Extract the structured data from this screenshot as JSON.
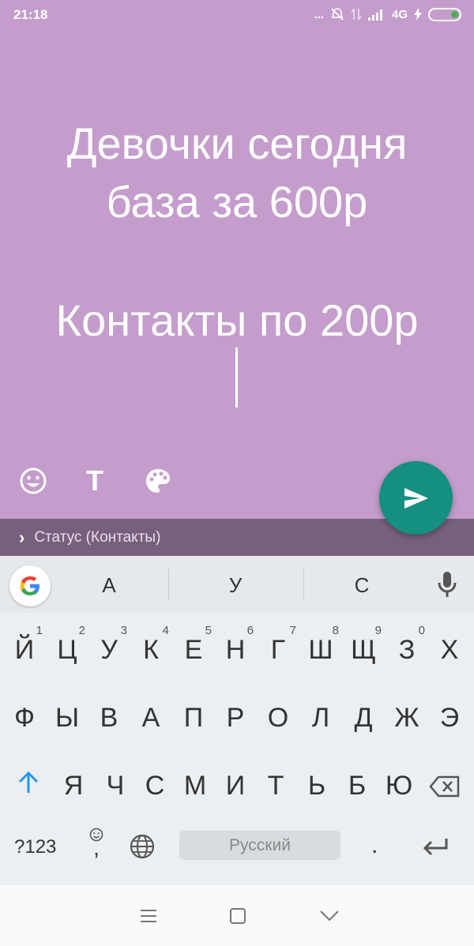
{
  "status_bar": {
    "time": "21:18",
    "dots": "...",
    "network": "4G"
  },
  "editor": {
    "lines": [
      "Девочки сегодня",
      "база за 600р",
      "Контакты по 200р"
    ],
    "background_color": "#c49dcc",
    "tools": {
      "text_tool_label": "T"
    }
  },
  "audience": {
    "label": "Статус (Контакты)"
  },
  "keyboard": {
    "suggestions": [
      "А",
      "У",
      "С"
    ],
    "row1": [
      {
        "ch": "Й",
        "num": "1"
      },
      {
        "ch": "Ц",
        "num": "2"
      },
      {
        "ch": "У",
        "num": "3"
      },
      {
        "ch": "К",
        "num": "4"
      },
      {
        "ch": "Е",
        "num": "5"
      },
      {
        "ch": "Н",
        "num": "6"
      },
      {
        "ch": "Г",
        "num": "7"
      },
      {
        "ch": "Ш",
        "num": "8"
      },
      {
        "ch": "Щ",
        "num": "9"
      },
      {
        "ch": "З",
        "num": "0"
      },
      {
        "ch": "Х",
        "num": ""
      }
    ],
    "row2": [
      "Ф",
      "Ы",
      "В",
      "А",
      "П",
      "Р",
      "О",
      "Л",
      "Д",
      "Ж",
      "Э"
    ],
    "row3": [
      "Я",
      "Ч",
      "С",
      "М",
      "И",
      "Т",
      "Ь",
      "Б",
      "Ю"
    ],
    "symbols_label": "?123",
    "comma_label": ",",
    "space_label": "Русский",
    "period_label": "."
  },
  "icons": {
    "send": "send-icon",
    "emoji": "emoji-icon",
    "palette": "palette-icon",
    "google": "google-icon",
    "mic": "mic-icon",
    "shift": "shift-icon",
    "backspace": "backspace-icon",
    "globe": "globe-icon",
    "enter": "enter-icon"
  },
  "colors": {
    "accent": "#148f80",
    "audience_bar": "#77607d",
    "shift_blue": "#2196f3"
  }
}
